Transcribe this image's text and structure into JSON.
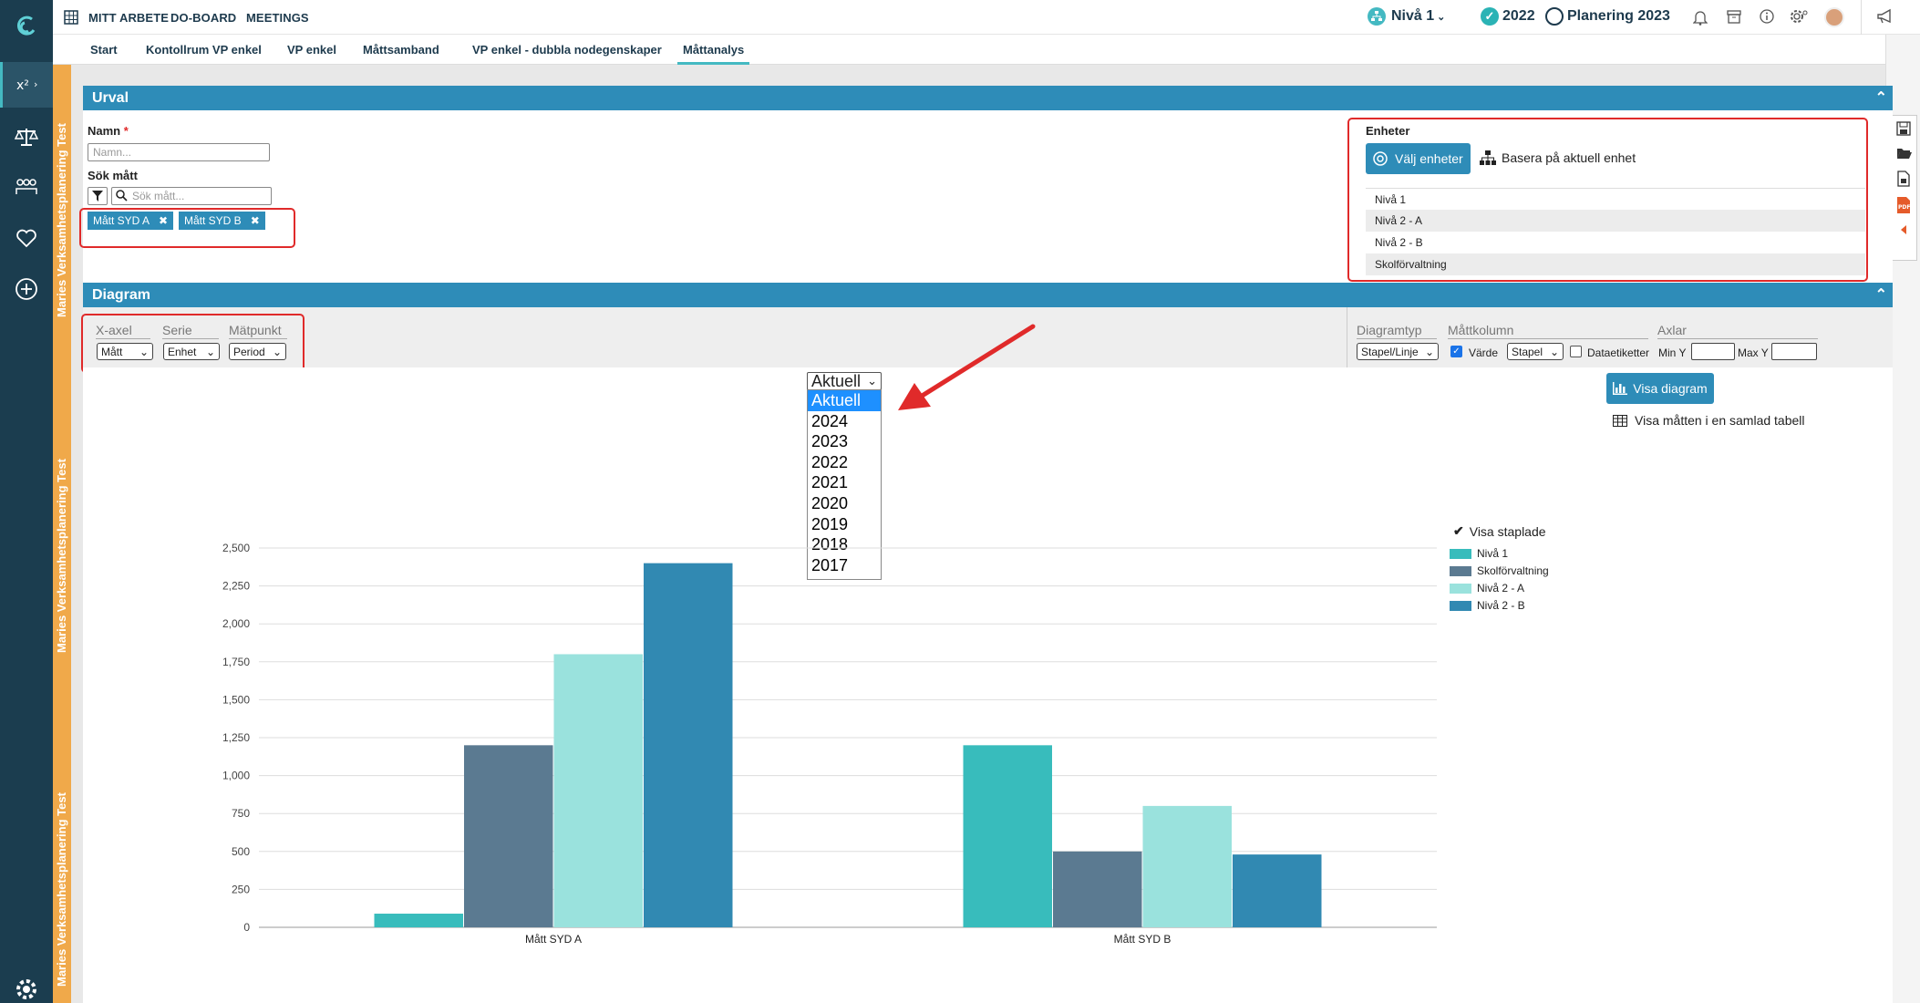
{
  "topnav": {
    "items": [
      "MITT ARBETE",
      "DO-BOARD",
      "MEETINGS"
    ]
  },
  "topright": {
    "level": "Nivå 1",
    "year": "2022",
    "plan": "Planering 2023"
  },
  "subtabs": [
    "Start",
    "Kontollrum VP enkel",
    "VP enkel",
    "Måttsamband",
    "VP enkel - dubbla nodegenskaper",
    "Måttanalys"
  ],
  "stripe_text": "Maries Verksamhetsplanering Test",
  "urval": {
    "title": "Urval",
    "name_label": "Namn",
    "required_mark": "*",
    "name_placeholder": "Namn...",
    "search_label": "Sök mått",
    "search_placeholder": "Sök mått...",
    "chips": [
      "Mått SYD A",
      "Mått SYD B"
    ],
    "chip_remove": "✖"
  },
  "enheter": {
    "title": "Enheter",
    "choose_button": "Välj enheter",
    "base_button": "Basera på aktuell enhet",
    "units": [
      "Nivå 1",
      "Nivå 2 - A",
      "Nivå 2 - B",
      "Skolförvaltning"
    ]
  },
  "diagram": {
    "title": "Diagram",
    "xaxis_label": "X-axel",
    "xaxis_value": "Mått",
    "serie_label": "Serie",
    "serie_value": "Enhet",
    "matpunkt_label": "Mätpunkt",
    "matpunkt_value": "Period",
    "diagramtyp_label": "Diagramtyp",
    "diagramtyp_value": "Stapel/Linje",
    "mattkolumn_label": "Måttkolumn",
    "varde_label": "Värde",
    "varde_checked": true,
    "stapel_value": "Stapel",
    "dataetiketter_label": "Dataetiketter",
    "axlar_label": "Axlar",
    "miny_label": "Min Y",
    "maxy_label": "Max Y",
    "show_button": "Visa diagram",
    "table_link": "Visa måtten i en samlad tabell",
    "period_select": "Aktuell",
    "period_options": [
      "Aktuell",
      "2024",
      "2023",
      "2022",
      "2021",
      "2020",
      "2019",
      "2018",
      "2017"
    ],
    "show_stacked": "Visa staplade"
  },
  "chart_data": {
    "type": "bar",
    "categories": [
      "Mått SYD A",
      "Mått SYD B"
    ],
    "series": [
      {
        "name": "Nivå 1",
        "values": [
          90,
          1200
        ],
        "color": "#38bcbc"
      },
      {
        "name": "Skolförvaltning",
        "values": [
          1200,
          500
        ],
        "color": "#5b7a91"
      },
      {
        "name": "Nivå 2 - A",
        "values": [
          1800,
          800
        ],
        "color": "#9ae2dd"
      },
      {
        "name": "Nivå 2 - B",
        "values": [
          2400,
          480
        ],
        "color": "#3189b2"
      }
    ],
    "ylim": [
      0,
      2500
    ],
    "yticks": [
      "0",
      "250",
      "500",
      "750",
      "1,000",
      "1,250",
      "1,500",
      "1,750",
      "2,000",
      "2,250",
      "2,500"
    ],
    "legend": "right",
    "grid": true
  },
  "colors": {
    "accent": "#2e8cb8",
    "nav": "#1b3d4f",
    "stripe": "#f0a94a",
    "highlight": "#e02a2a"
  }
}
